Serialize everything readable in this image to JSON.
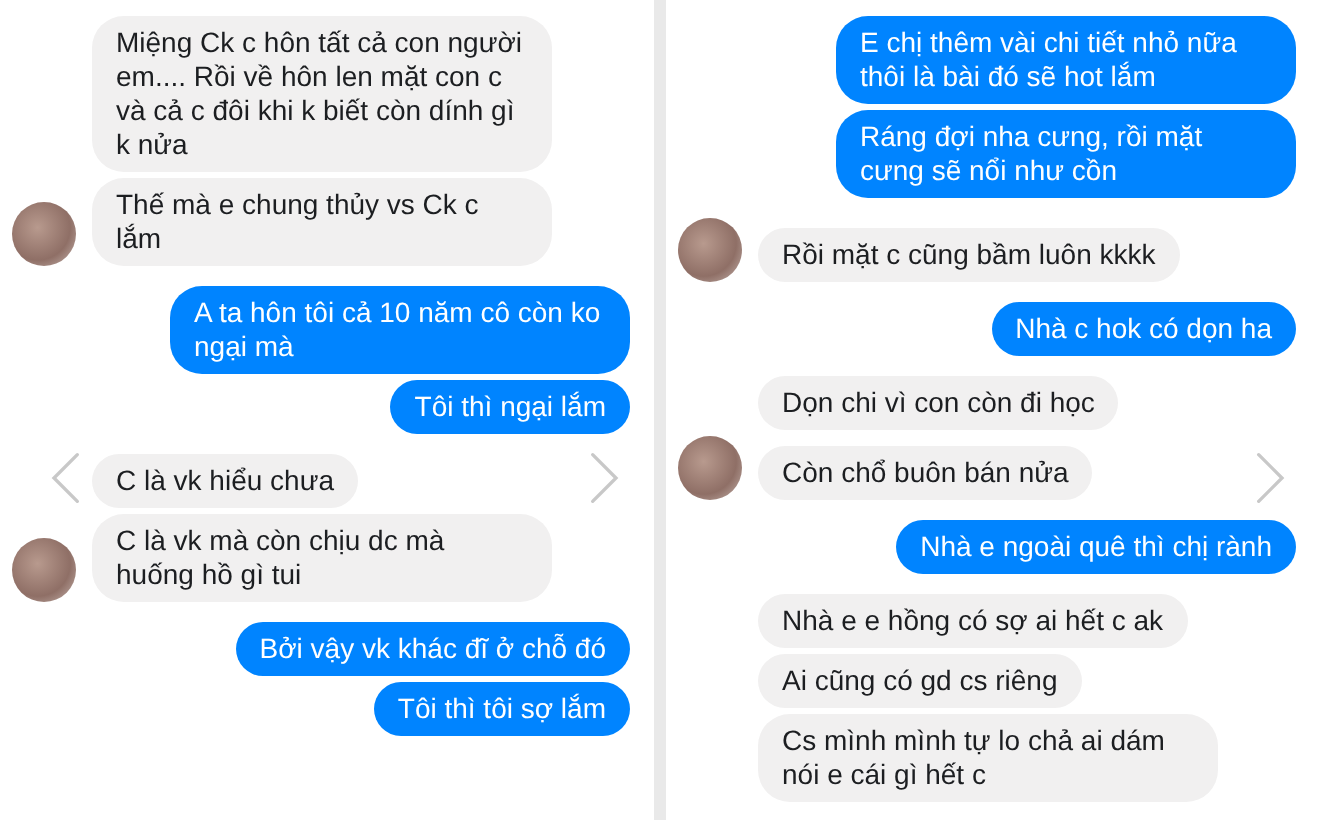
{
  "panels": [
    {
      "nav": {
        "prev": true,
        "next": true
      },
      "messages": [
        {
          "kind": "incoming",
          "text": "Miệng Ck c hôn tất cả con người em.... Rồi về hôn len mặt con c và cả c đôi khi k biết còn dính gì k nửa"
        },
        {
          "kind": "incoming",
          "avatar": true,
          "text": "Thế mà e chung thủy vs Ck c lắm"
        },
        {
          "kind": "outgoing",
          "text": "A ta hôn tôi cả 10 năm cô còn ko ngại mà"
        },
        {
          "kind": "outgoing",
          "text": "Tôi thì ngại lắm"
        },
        {
          "kind": "incoming",
          "text": "C là vk hiểu chưa"
        },
        {
          "kind": "incoming",
          "avatar": true,
          "text": "C là vk mà còn chịu dc mà huống hồ gì tui"
        },
        {
          "kind": "outgoing",
          "text": "Bởi vậy vk khác đĩ ở chỗ đó"
        },
        {
          "kind": "outgoing",
          "text": "Tôi thì tôi sợ lắm"
        }
      ]
    },
    {
      "nav": {
        "next": true
      },
      "messages": [
        {
          "kind": "outgoing",
          "text": "E chị thêm vài chi tiết nhỏ nữa thôi là bài đó sẽ hot lắm"
        },
        {
          "kind": "outgoing",
          "text": "Ráng đợi nha cưng, rồi mặt cưng sẽ nổi như cồn"
        },
        {
          "kind": "incoming",
          "avatar": true,
          "text": "Rồi mặt c cũng bầm luôn kkkk"
        },
        {
          "kind": "outgoing",
          "text": "Nhà c hok có dọn ha"
        },
        {
          "kind": "incoming",
          "text": "Dọn chi vì con còn đi học"
        },
        {
          "kind": "incoming",
          "avatar": true,
          "text": "Còn chổ buôn bán nửa"
        },
        {
          "kind": "outgoing",
          "text": "Nhà e ngoài quê thì chị rành"
        },
        {
          "kind": "incoming",
          "text": "Nhà e e hồng có sợ ai hết c ak"
        },
        {
          "kind": "incoming",
          "text": "Ai cũng có gd cs riêng"
        },
        {
          "kind": "incoming",
          "text": "Cs mình mình tự lo chả ai dám nói e cái gì hết c"
        }
      ]
    }
  ]
}
